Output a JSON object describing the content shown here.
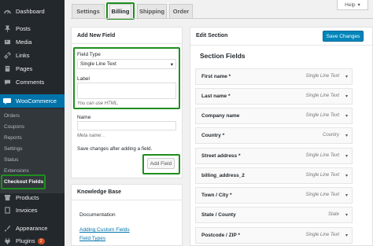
{
  "sidebar": {
    "items": [
      {
        "label": "Dashboard",
        "icon": "dashboard-icon"
      },
      {
        "label": "Posts",
        "icon": "pin-icon"
      },
      {
        "label": "Media",
        "icon": "media-icon"
      },
      {
        "label": "Links",
        "icon": "link-icon"
      },
      {
        "label": "Pages",
        "icon": "page-icon"
      },
      {
        "label": "Comments",
        "icon": "comment-icon"
      },
      {
        "label": "WooCommerce",
        "icon": "woo-icon"
      },
      {
        "label": "Products",
        "icon": "archive-icon"
      },
      {
        "label": "Invoices",
        "icon": "invoice-icon"
      },
      {
        "label": "Appearance",
        "icon": "brush-icon"
      },
      {
        "label": "Plugins",
        "icon": "plug-icon",
        "badge": "2"
      }
    ],
    "submenu": [
      "Orders",
      "Coupons",
      "Reports",
      "Settings",
      "Status",
      "Extensions",
      "Checkout Fields"
    ]
  },
  "tabs": [
    "Settings",
    "Billing",
    "Shipping",
    "Order"
  ],
  "help_label": "Help",
  "add_field": {
    "title": "Add New Field",
    "field_type_label": "Field Type",
    "field_type_value": "Single Line Text",
    "label_label": "Label",
    "label_hint": "You can use HTML.",
    "name_label": "Name",
    "name_hint": "Meta name: .",
    "save_note": "Save changes after adding a field.",
    "button": "Add Field"
  },
  "knowledge_base": {
    "title": "Knowledge Base",
    "doc_heading": "Documentation",
    "links": [
      "Adding Custom Fields",
      "Field Types"
    ]
  },
  "edit_section": {
    "title": "Edit Section",
    "save_button": "Save Changes",
    "section_fields_title": "Section Fields",
    "fields": [
      {
        "name": "First name *",
        "type": "Single Line Text"
      },
      {
        "name": "Last name *",
        "type": "Single Line Text"
      },
      {
        "name": "Company name",
        "type": "Single Line Text"
      },
      {
        "name": "Country *",
        "type": "Country"
      },
      {
        "name": "Street address *",
        "type": "Single Line Text"
      },
      {
        "name": "billing_address_2",
        "type": "Single Line Text"
      },
      {
        "name": "Town / City *",
        "type": "Single Line Text"
      },
      {
        "name": "State / County",
        "type": "State"
      },
      {
        "name": "Postcode / ZIP *",
        "type": "Single Line Text"
      }
    ]
  },
  "colors": {
    "sidebar_bg": "#23282d",
    "accent": "#0073aa",
    "highlight": "#1e8f1e",
    "primary_button": "#0085ba"
  }
}
